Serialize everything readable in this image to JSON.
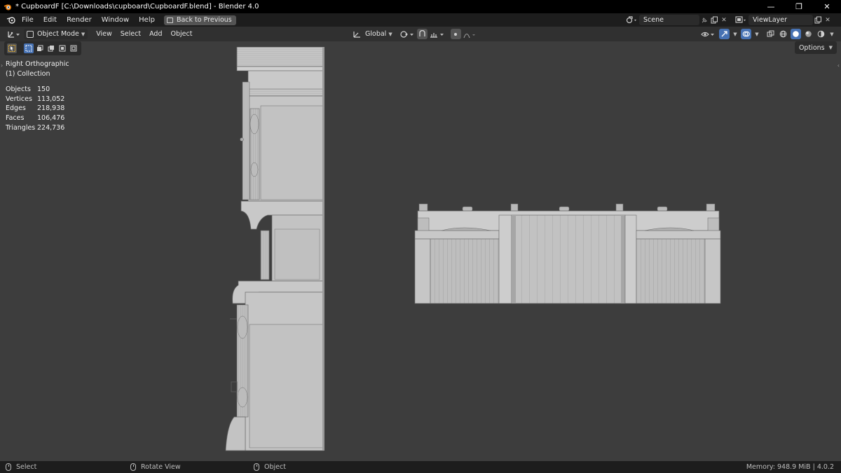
{
  "window": {
    "title": "* CupboardF [C:\\Downloads\\cupboard\\CupboardF.blend] - Blender 4.0",
    "minimize": "—",
    "maximize": "❐",
    "close": "✕"
  },
  "menu": {
    "items": [
      "File",
      "Edit",
      "Render",
      "Window",
      "Help"
    ],
    "back_button": "Back to Previous"
  },
  "scene": {
    "label": "Scene"
  },
  "view_layer": {
    "label": "ViewLayer"
  },
  "viewport_header": {
    "mode": "Object Mode",
    "items": [
      "View",
      "Select",
      "Add",
      "Object"
    ],
    "orientation": "Global"
  },
  "viewport": {
    "options_label": "Options",
    "view_name": "Right Orthographic",
    "collection": "(1) Collection",
    "stats": [
      {
        "label": "Objects",
        "value": "150"
      },
      {
        "label": "Vertices",
        "value": "113,052"
      },
      {
        "label": "Edges",
        "value": "218,938"
      },
      {
        "label": "Faces",
        "value": "106,476"
      },
      {
        "label": "Triangles",
        "value": "224,736"
      }
    ]
  },
  "statusbar": {
    "select": "Select",
    "rotate": "Rotate View",
    "object": "Object",
    "memory": "Memory: 948.9 MiB | 4.0.2"
  },
  "colors": {
    "accent": "#4772b3",
    "viewport_bg": "#3d3d3d",
    "header_bg": "#303030",
    "topbar_bg": "#1d1d1d",
    "model_gray": "#c8c8c8"
  }
}
